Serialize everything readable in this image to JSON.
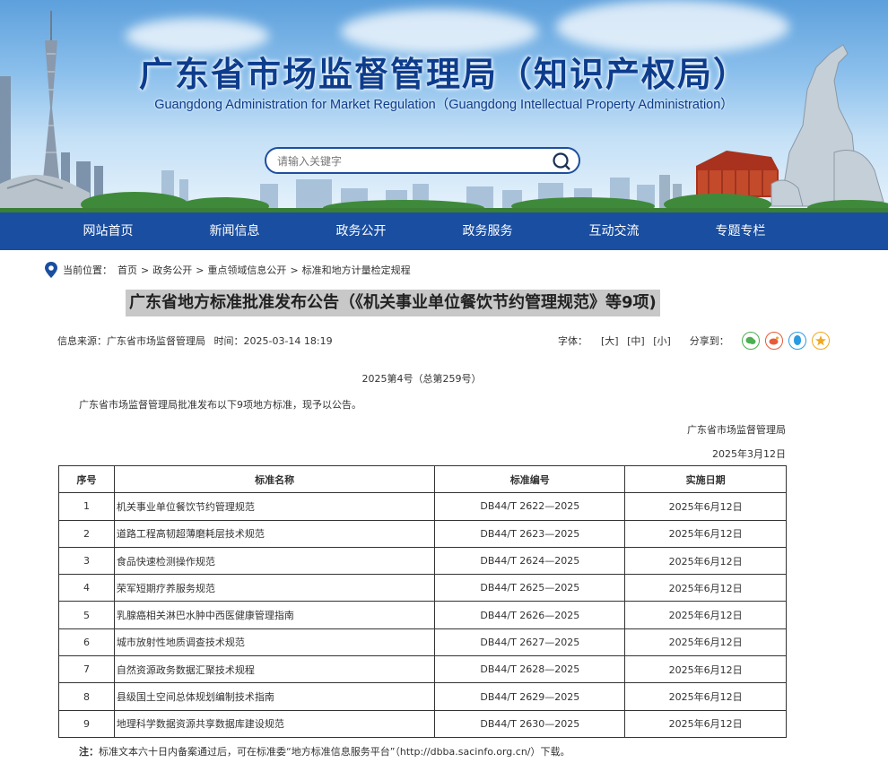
{
  "header": {
    "title_cn": "广东省市场监督管理局（知识产权局）",
    "title_en": "Guangdong Administration for Market Regulation（Guangdong Intellectual Property Administration）",
    "search_placeholder": "请输入关键字"
  },
  "nav": [
    "网站首页",
    "新闻信息",
    "政务公开",
    "政务服务",
    "互动交流",
    "专题专栏"
  ],
  "breadcrumb": {
    "label": "当前位置：",
    "items": [
      "首页",
      "政务公开",
      "重点领域信息公开",
      "标准和地方计量检定规程"
    ],
    "separator": ">"
  },
  "article": {
    "title": "广东省地方标准批准发布公告（《机关事业单位餐饮节约管理规范》等9项)",
    "source_label": "信息来源：",
    "source": "广东省市场监督管理局",
    "time_label": "时间：",
    "time": "2025-03-14 18:19",
    "font_label": "字体：",
    "font_sizes": [
      "[大]",
      "[中]",
      "[小]"
    ],
    "share_label": "分享到：",
    "doc_number": "2025第4号（总第259号）",
    "intro": "广东省市场监督管理局批准发布以下9项地方标准，现予以公告。",
    "signer": "广东省市场监督管理局",
    "sign_date": "2025年3月12日"
  },
  "table": {
    "headers": [
      "序号",
      "标准名称",
      "标准编号",
      "实施日期"
    ],
    "rows": [
      [
        "1",
        "机关事业单位餐饮节约管理规范",
        "DB44/T 2622—2025",
        "2025年6月12日"
      ],
      [
        "2",
        "道路工程高韧超薄磨耗层技术规范",
        "DB44/T 2623—2025",
        "2025年6月12日"
      ],
      [
        "3",
        "食品快速检测操作规范",
        "DB44/T 2624—2025",
        "2025年6月12日"
      ],
      [
        "4",
        "荣军短期疗养服务规范",
        "DB44/T 2625—2025",
        "2025年6月12日"
      ],
      [
        "5",
        "乳腺癌相关淋巴水肿中西医健康管理指南",
        "DB44/T 2626—2025",
        "2025年6月12日"
      ],
      [
        "6",
        "城市放射性地质调查技术规范",
        "DB44/T 2627—2025",
        "2025年6月12日"
      ],
      [
        "7",
        "自然资源政务数据汇聚技术规程",
        "DB44/T 2628—2025",
        "2025年6月12日"
      ],
      [
        "8",
        "县级国土空间总体规划编制技术指南",
        "DB44/T 2629—2025",
        "2025年6月12日"
      ],
      [
        "9",
        "地理科学数据资源共享数据库建设规范",
        "DB44/T 2630—2025",
        "2025年6月12日"
      ]
    ]
  },
  "note": {
    "label": "注：",
    "text": "标准文本六十日内备案通过后，可在标准委“地方标准信息服务平台”（http://dbba.sacinfo.org.cn/）下载。"
  },
  "colors": {
    "nav_bg": "#1a4ea0",
    "title_color": "#0d3c8c",
    "title_highlight": "#c8c8c8"
  }
}
